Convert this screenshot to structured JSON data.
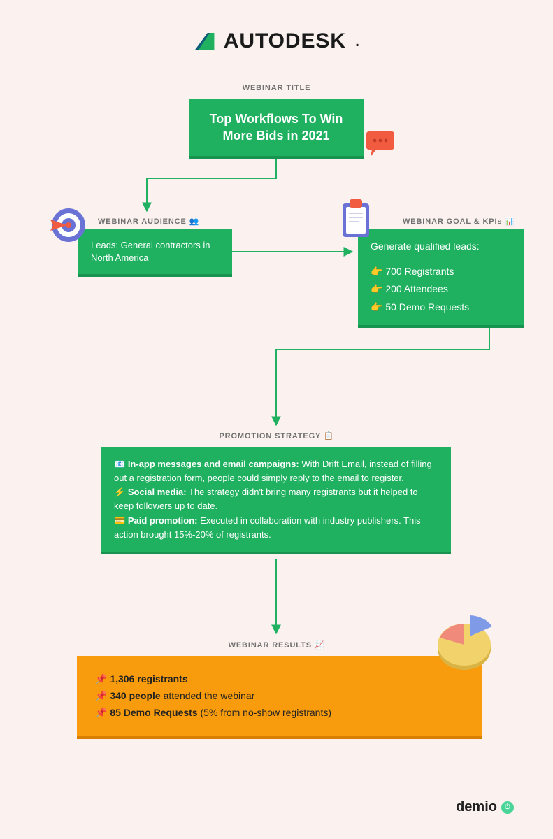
{
  "brand": "AUTODESK",
  "labels": {
    "title": "WEBINAR TITLE",
    "audience": "WEBINAR AUDIENCE 👥",
    "goal": "WEBINAR GOAL & KPIs 📊",
    "promo": "PROMOTION STRATEGY 📋",
    "results": "WEBINAR RESULTS 📈"
  },
  "title_box": "Top Workflows To Win More Bids in 2021",
  "audience_box": "Leads: General contractors in North America",
  "goal_box": {
    "headline": "Generate qualified leads:",
    "items": [
      "👉 700 Registrants",
      "👉 200 Attendees",
      "👉 50 Demo Requests"
    ]
  },
  "promo_box": {
    "items": [
      {
        "icon": "📧",
        "strong": "In-app messages and email campaigns:",
        "rest": " With Drift Email, instead of filling out a registration form, people could simply reply to the email to register."
      },
      {
        "icon": "⚡",
        "strong": "Social media:",
        "rest": " The strategy didn't bring many registrants but it helped to keep followers up to date."
      },
      {
        "icon": "💳",
        "strong": "Paid promotion:",
        "rest": " Executed in collaboration with industry publishers. This action brought 15%-20% of registrants."
      }
    ]
  },
  "results_box": {
    "items": [
      {
        "icon": "📌",
        "strong": "1,306 registrants",
        "rest": ""
      },
      {
        "icon": "📌",
        "strong": "340 people",
        "rest": " attended the webinar"
      },
      {
        "icon": "📌",
        "strong": "85 Demo Requests",
        "rest": " (5% from no-show registrants)"
      }
    ]
  },
  "footer_brand": "demio",
  "chart_data": {
    "pie_decoration": {
      "type": "pie",
      "slices": [
        {
          "color": "#f2d36b",
          "value": 60
        },
        {
          "color": "#f08b7c",
          "value": 25
        },
        {
          "color": "#7f9ae6",
          "value": 15
        }
      ],
      "note": "decorative only — proportions estimated from graphic"
    }
  }
}
